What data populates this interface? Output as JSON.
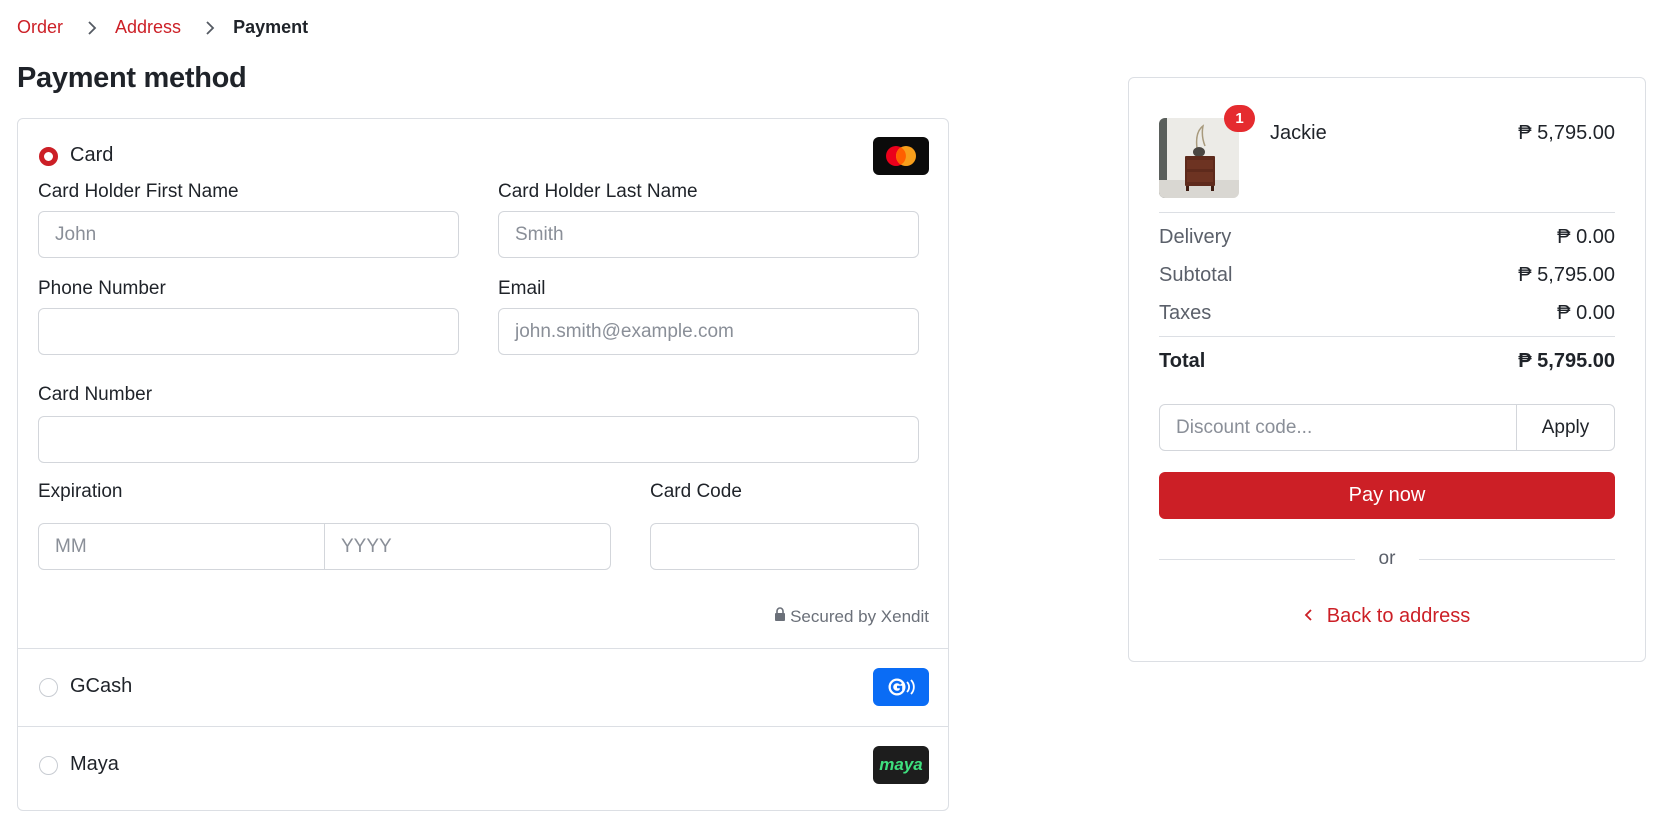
{
  "breadcrumb": {
    "items": [
      {
        "label": "Order"
      },
      {
        "label": "Address"
      },
      {
        "label": "Payment"
      }
    ]
  },
  "page_title": "Payment method",
  "methods": {
    "card": {
      "label": "Card",
      "selected": true,
      "icon": "mastercard-icon"
    },
    "gcash": {
      "label": "GCash",
      "selected": false,
      "icon": "gcash-icon"
    },
    "maya": {
      "label": "Maya",
      "selected": false,
      "icon": "maya-icon",
      "brand_text": "maya"
    }
  },
  "card_form": {
    "first_name": {
      "label": "Card Holder First Name",
      "placeholder": "John",
      "value": ""
    },
    "last_name": {
      "label": "Card Holder Last Name",
      "placeholder": "Smith",
      "value": ""
    },
    "phone": {
      "label": "Phone Number",
      "placeholder": "",
      "value": ""
    },
    "email": {
      "label": "Email",
      "placeholder": "john.smith@example.com",
      "value": ""
    },
    "card_number": {
      "label": "Card Number",
      "placeholder": "",
      "value": ""
    },
    "expiration": {
      "label": "Expiration",
      "month_placeholder": "MM",
      "year_placeholder": "YYYY"
    },
    "card_code": {
      "label": "Card Code",
      "placeholder": "",
      "value": ""
    },
    "secured_text": "Secured by Xendit"
  },
  "summary": {
    "product": {
      "name": "Jackie",
      "price": "₱ 5,795.00",
      "quantity": "1"
    },
    "rows": {
      "delivery": {
        "label": "Delivery",
        "value": "₱ 0.00"
      },
      "subtotal": {
        "label": "Subtotal",
        "value": "₱ 5,795.00"
      },
      "taxes": {
        "label": "Taxes",
        "value": "₱ 0.00"
      },
      "total": {
        "label": "Total",
        "value": "₱ 5,795.00"
      }
    },
    "discount": {
      "placeholder": "Discount code...",
      "apply_label": "Apply"
    },
    "pay_label": "Pay now",
    "or_text": "or",
    "back_label": "Back to address"
  },
  "colors": {
    "accent": "#cc1f26",
    "badge": "#e52b2f",
    "gcash": "#0a6cf5",
    "maya_bg": "#1d1d1d",
    "maya_text": "#3ee07e"
  }
}
